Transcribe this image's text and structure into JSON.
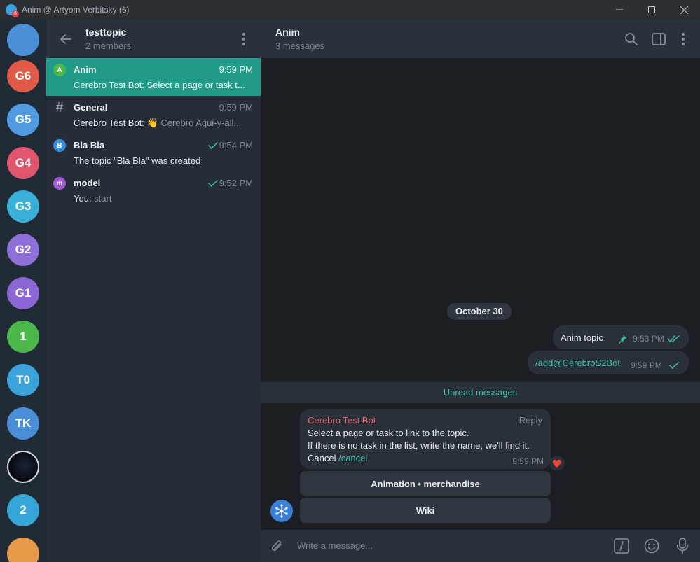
{
  "window": {
    "title": "Anim @ Artyom Verbitsky (6)",
    "badge": "6",
    "controls": {
      "minimize": "minimize-icon",
      "maximize": "maximize-icon",
      "close": "close-icon"
    }
  },
  "rail": {
    "menu_icon": "menu-icon",
    "avatars": [
      {
        "label": "",
        "color": "#4a90d9"
      },
      {
        "label": "G6",
        "color": "#e05a48"
      },
      {
        "label": "G5",
        "color": "#4f9ae0"
      },
      {
        "label": "G4",
        "color": "#e0566e"
      },
      {
        "label": "G3",
        "color": "#3ab0d8"
      },
      {
        "label": "G2",
        "color": "#8f6fd8"
      },
      {
        "label": "G1",
        "color": "#8b67d6"
      },
      {
        "label": "1",
        "color": "#4cb84a"
      },
      {
        "label": "T0",
        "color": "#3aa3dc"
      },
      {
        "label": "TK",
        "color": "#4a8ed8"
      },
      {
        "label": "",
        "color": "#0c0f18"
      },
      {
        "label": "2",
        "color": "#36a6d9"
      },
      {
        "label": "",
        "color": "#e89a4a"
      }
    ]
  },
  "chat_list": {
    "title": "testtopic",
    "subtitle": "2 members",
    "topics": [
      {
        "icon_letter": "A",
        "icon_color": "#4cb84a",
        "name": "Anim",
        "time": "9:59 PM",
        "preview_sender": "Cerebro Test Bot:",
        "preview_text": "Select a page or task t...",
        "active": true,
        "checks": ""
      },
      {
        "icon_letter": "#",
        "icon_color": "",
        "name": "General",
        "time": "9:59 PM",
        "preview_sender": "Cerebro Test Bot:",
        "preview_emoji": "👋",
        "preview_text": "Cerebro Aqui-y-all...",
        "active": false,
        "checks": ""
      },
      {
        "icon_letter": "B",
        "icon_color": "#3a8ee0",
        "name": "Bla Bla",
        "time": "9:54 PM",
        "preview_text": "The topic \"Bla Bla\" was created",
        "active": false,
        "checks": "single"
      },
      {
        "icon_letter": "m",
        "icon_color": "#a05ad8",
        "name": "model",
        "time": "9:52 PM",
        "preview_sender": "You:",
        "preview_text": "start",
        "active": false,
        "checks": "single"
      }
    ]
  },
  "chat": {
    "title": "Anim",
    "subtitle": "3 messages",
    "date_separator": "October 30",
    "outgoing": [
      {
        "text": "Anim topic",
        "time": "9:53 PM",
        "pinned": true,
        "checks": "double"
      },
      {
        "text": "/add@CerebroS2Bot",
        "time": "9:59 PM",
        "pinned": false,
        "checks": "single"
      }
    ],
    "unread_label": "Unread messages",
    "incoming": {
      "sender": "Cerebro Test Bot",
      "reply_label": "Reply",
      "line1": "Select a page or task to link to the topic.",
      "line2": "If there is no task in the list, write the name, we'll find it.",
      "line3_prefix": "Cancel",
      "line3_link": "/cancel",
      "time": "9:59 PM",
      "reaction": "❤️"
    },
    "keyboard": [
      {
        "label": "Animation • merchandise"
      },
      {
        "label": "Wiki"
      }
    ],
    "composer": {
      "placeholder": "Write a message..."
    }
  },
  "colors": {
    "accent": "#229a8a",
    "link": "#3fbfa9",
    "sender": "#e8646a"
  }
}
